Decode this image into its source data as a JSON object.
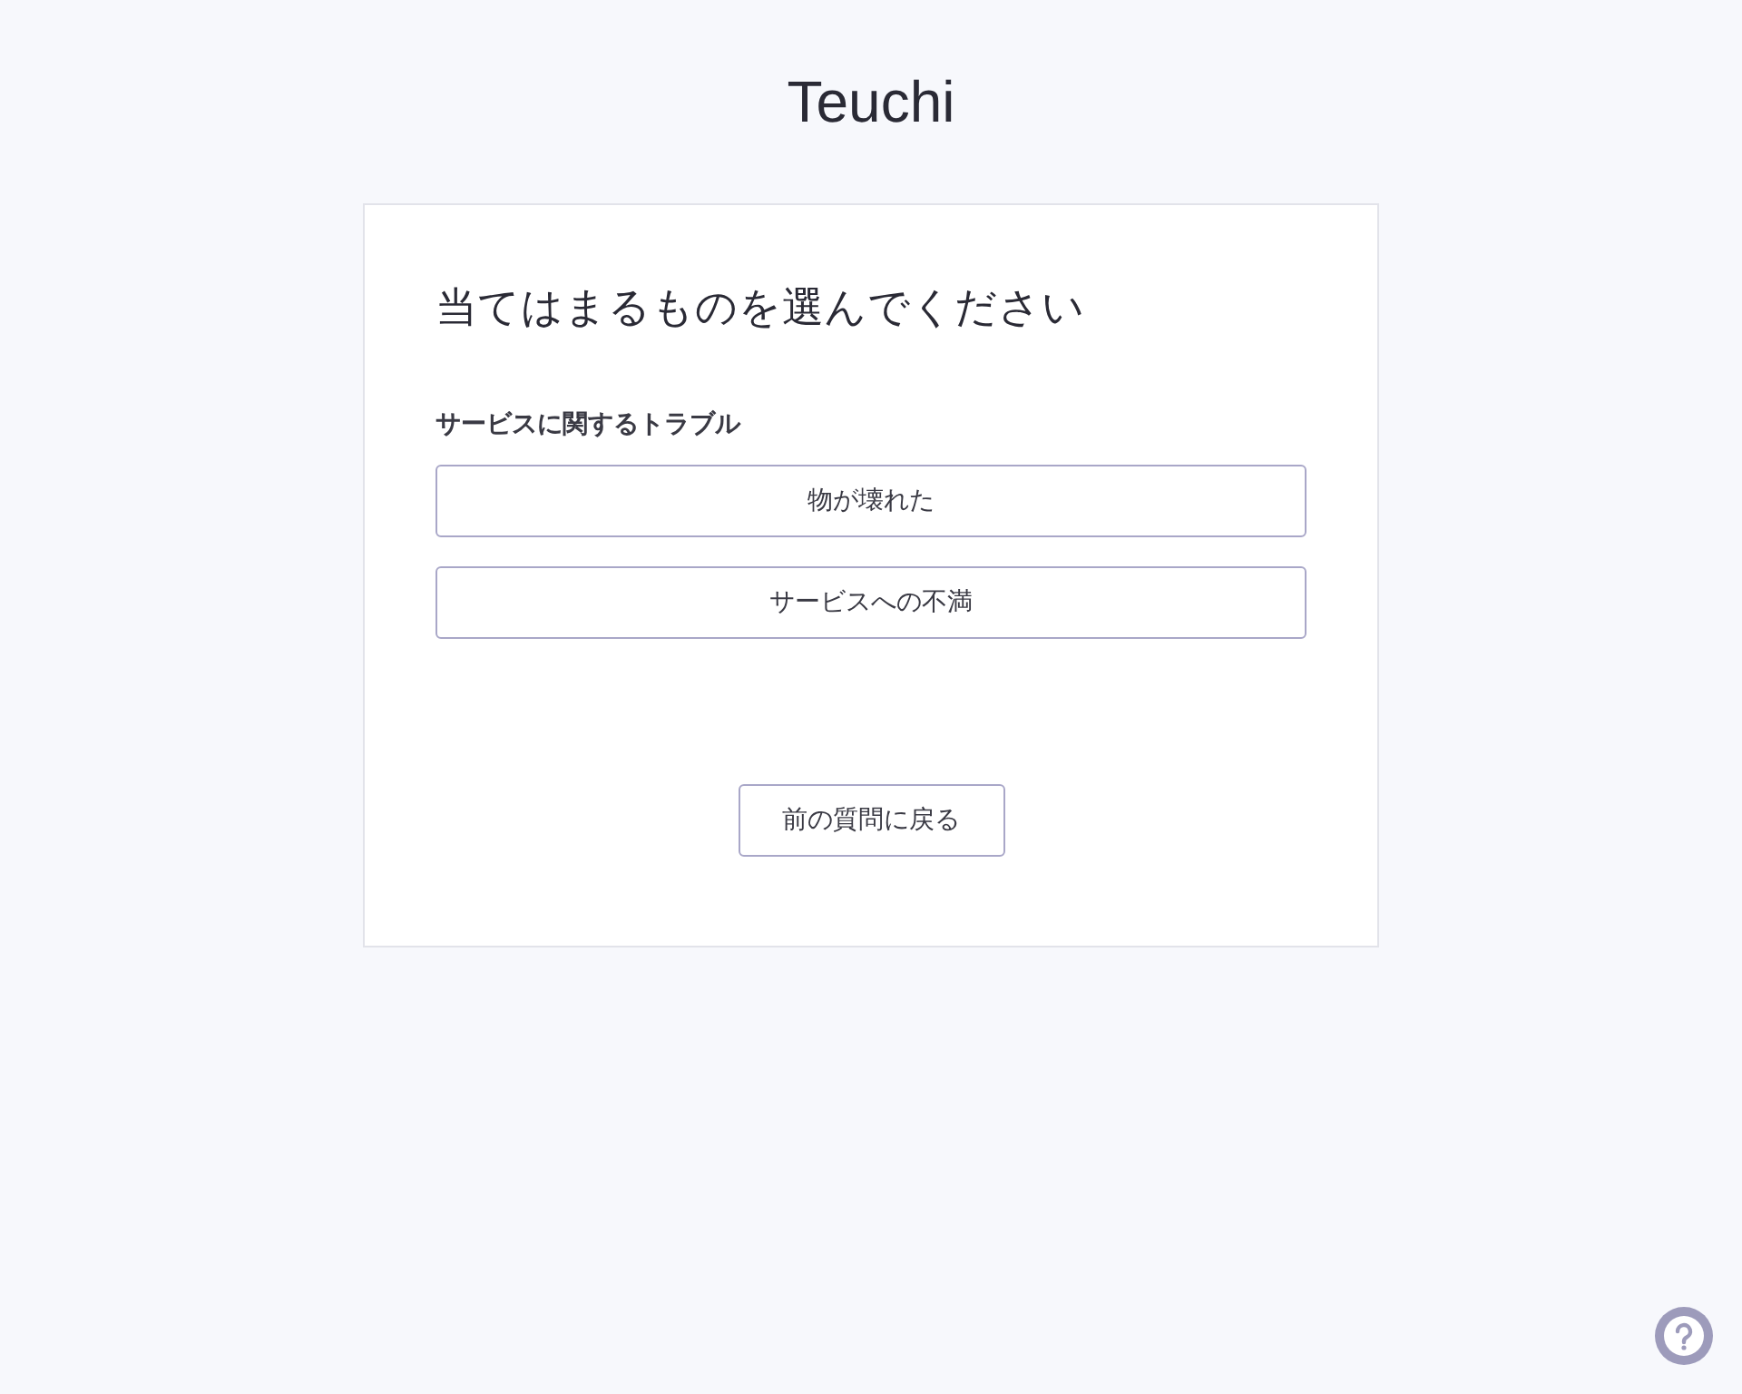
{
  "brand": "Teuchi",
  "card": {
    "title": "当てはまるものを選んでください",
    "section": "サービスに関するトラブル",
    "options": [
      {
        "label": "物が壊れた"
      },
      {
        "label": "サービスへの不満"
      }
    ],
    "back_button": "前の質問に戻る"
  }
}
